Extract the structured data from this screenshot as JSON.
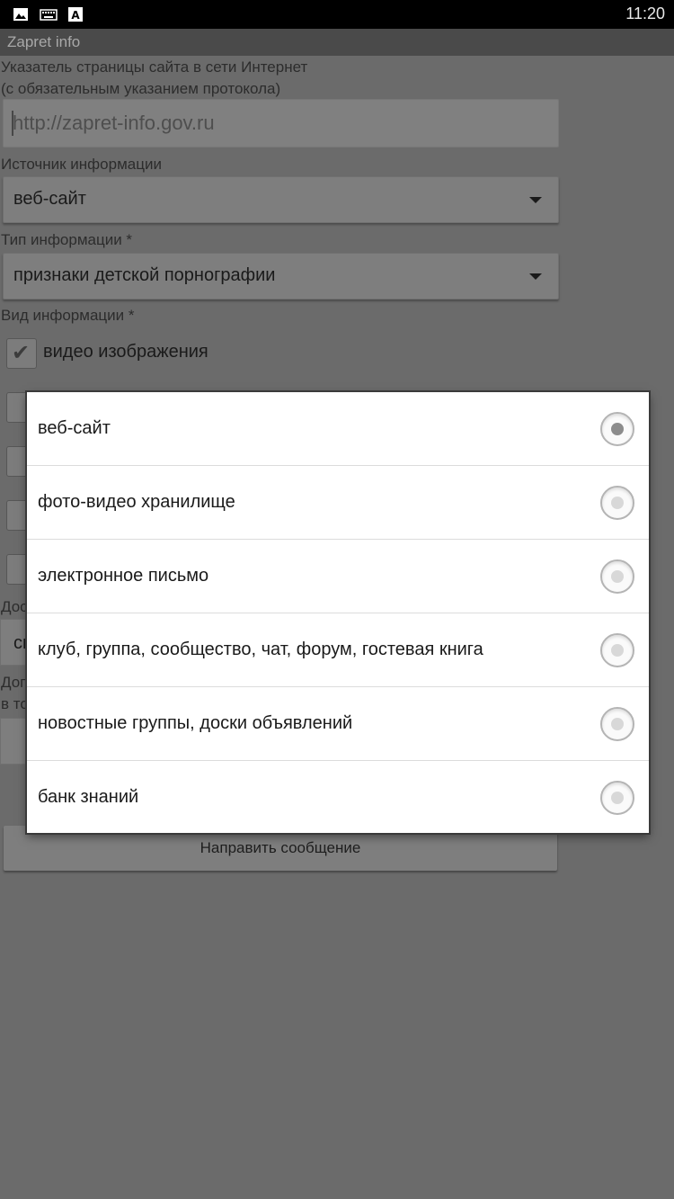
{
  "status_bar": {
    "time": "11:20",
    "icons": [
      "image-icon",
      "keyboard-icon",
      "text-icon"
    ]
  },
  "app": {
    "title": "Zapret info"
  },
  "form": {
    "url_label_line1": "Указатель страницы сайта в сети Интернет",
    "url_label_line2": "(с обязательным указанием протокола)",
    "url_placeholder": "http://zapret-info.gov.ru",
    "source_label": "Источник информации",
    "source_value": "веб-сайт",
    "type_label": "Тип информации *",
    "type_value": "признаки детской порнографии",
    "kind_label": "Вид информации *",
    "kind_checkbox_label": "видео изображения",
    "kind_checkbox_checked": true,
    "partial_label_1": "Дос",
    "partial_select_text": "сн",
    "partial_label_2a": "Доп",
    "partial_label_2b": "в то",
    "submit_label": "Направить сообщение"
  },
  "dialog": {
    "options": [
      {
        "label": "веб-сайт",
        "selected": true
      },
      {
        "label": "фото-видео хранилище",
        "selected": false
      },
      {
        "label": "электронное письмо",
        "selected": false
      },
      {
        "label": "клуб, группа, сообщество, чат, форум, гостевая книга",
        "selected": false
      },
      {
        "label": "новостные группы, доски объявлений",
        "selected": false
      },
      {
        "label": "банк знаний",
        "selected": false
      }
    ]
  }
}
